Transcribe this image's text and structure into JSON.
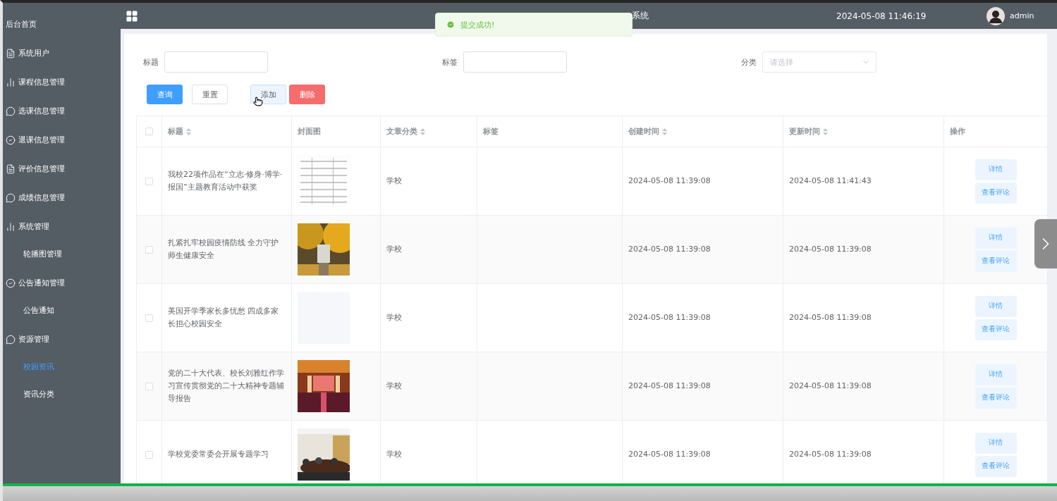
{
  "sidebar": {
    "items": [
      {
        "label": "后台首页",
        "selected": false
      },
      {
        "label": "系统用户",
        "selected": false
      },
      {
        "label": "课程信息管理",
        "selected": false
      },
      {
        "label": "选课信息管理",
        "selected": false
      },
      {
        "label": "退课信息管理",
        "selected": false
      },
      {
        "label": "评价信息管理",
        "selected": false
      },
      {
        "label": "成绩信息管理",
        "selected": false
      },
      {
        "label": "系统管理",
        "selected": false,
        "children": [
          {
            "label": "轮播图管理",
            "selected": false
          }
        ]
      },
      {
        "label": "公告通知管理",
        "selected": false,
        "children": [
          {
            "label": "公告通知",
            "selected": false
          }
        ]
      },
      {
        "label": "资源管理",
        "selected": false,
        "children": [
          {
            "label": "校园资讯",
            "selected": true
          },
          {
            "label": "资讯分类",
            "selected": false
          }
        ]
      }
    ]
  },
  "header": {
    "title": "系统",
    "datetime": "2024-05-08 11:46:19",
    "user": "admin"
  },
  "toast": {
    "message": "提交成功!"
  },
  "filters": [
    {
      "label": "标题",
      "kind": "text"
    },
    {
      "label": "标签",
      "kind": "text"
    },
    {
      "label": "分类",
      "kind": "select",
      "placeholder": "请选择"
    }
  ],
  "buttons": [
    {
      "label": "查询",
      "kind": "primary"
    },
    {
      "label": "重置",
      "kind": "default"
    },
    {
      "label": "添加",
      "kind": "hover"
    },
    {
      "label": "删除",
      "kind": "danger"
    }
  ],
  "table": {
    "select_all": {
      "checked": false
    },
    "columns": [
      {
        "label": "标题",
        "sortable": true
      },
      {
        "label": "封面图",
        "sortable": false
      },
      {
        "label": "文章分类",
        "sortable": true
      },
      {
        "label": "标签",
        "sortable": false
      },
      {
        "label": "创建时间",
        "sortable": true
      },
      {
        "label": "更新时间",
        "sortable": true
      },
      {
        "label": "操作",
        "sortable": false
      }
    ],
    "rows": [
      {
        "checked": false,
        "title": "我校22项作品在“立志·修身·博学·报国”主题教育活动中获奖",
        "cover": {
          "kind": "picture"
        },
        "category": "学校",
        "created": "2024-05-08 11:39:08",
        "updated": "2024-05-08 11:41:43",
        "actions": [
          "详情",
          "查看评论"
        ]
      },
      {
        "checked": false,
        "title": "扎紧扎牢校园疫情防线 全力守护师生健康安全",
        "cover": {
          "kind": "picture"
        },
        "category": "学校",
        "created": "2024-05-08 11:39:08",
        "updated": "2024-05-08 11:39:08",
        "actions": [
          "详情",
          "查看评论"
        ]
      },
      {
        "checked": false,
        "title": "美国开学季家长多忧愁 四成多家长担心校园安全",
        "cover": {
          "kind": "empty"
        },
        "category": "学校",
        "created": "2024-05-08 11:39:08",
        "updated": "2024-05-08 11:39:08",
        "actions": [
          "详情",
          "查看评论"
        ]
      },
      {
        "checked": false,
        "title": "党的二十大代表、校长刘雅红作学习宣传贯彻党的二十大精神专题辅导报告",
        "cover": {
          "kind": "picture"
        },
        "category": "学校",
        "created": "2024-05-08 11:39:08",
        "updated": "2024-05-08 11:39:08",
        "actions": [
          "详情",
          "查看评论"
        ]
      },
      {
        "checked": false,
        "title": "学校党委常委会开展专题学习",
        "cover": {
          "kind": "picture"
        },
        "category": "学校",
        "created": "2024-05-08 11:39:08",
        "updated": "2024-05-08 11:39:08",
        "actions": [
          "详情",
          "查看评论"
        ]
      }
    ]
  },
  "player": {
    "progress": {
      "level": 1
    }
  }
}
